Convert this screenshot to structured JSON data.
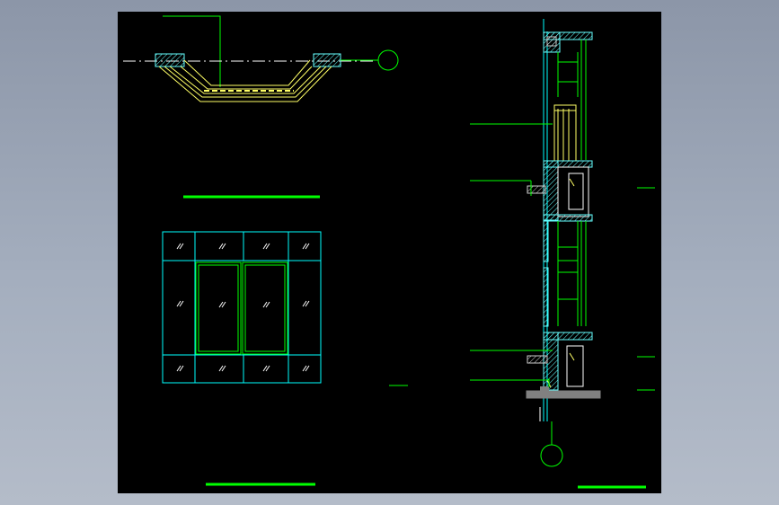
{
  "app": {
    "title": "",
    "background_gradient": [
      "#8c96a8",
      "#b4bcc9"
    ],
    "canvas_color": "#000000"
  },
  "colors": {
    "green": "#00ff00",
    "yellow": "#ffff66",
    "cyan": "#00ffff",
    "white": "#ffffff",
    "gray": "#808080",
    "hatch_cyan": "#66ffff"
  },
  "drawing": {
    "views": [
      {
        "id": "bay-window-plan",
        "description_color": "yellow"
      },
      {
        "id": "window-elevation",
        "description_color": "cyan"
      },
      {
        "id": "wall-section",
        "description_color": "cyan"
      }
    ],
    "grid_bubbles": [
      {
        "id": "plan-axis-bubble",
        "label": ""
      },
      {
        "id": "section-axis-bubble",
        "label": ""
      }
    ],
    "title_underlines": [
      {
        "id": "plan-title-underline",
        "text": ""
      },
      {
        "id": "elevation-title-underline",
        "text": ""
      },
      {
        "id": "section-title-underline",
        "text": ""
      }
    ]
  }
}
